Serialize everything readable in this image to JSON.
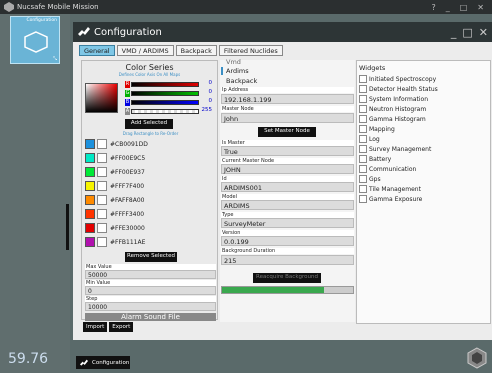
{
  "window": {
    "title": "Nucsafe Mobile Mission",
    "controls": [
      "?",
      "_",
      "□",
      "✕"
    ]
  },
  "sidebar": {
    "tile_label": "Configuration",
    "clock": "59.76"
  },
  "config": {
    "title": "Configuration",
    "controls": [
      "_",
      "□",
      "✕"
    ],
    "tabs": [
      "General",
      "VMD / ARDIMS",
      "Backpack",
      "Filtered Nuclides"
    ],
    "active_tab": "General"
  },
  "color_series": {
    "title": "Color Series",
    "subtitle": "Defines Color Axis On All Maps",
    "channels": [
      {
        "name": "R",
        "value": "0",
        "color": "#e00000"
      },
      {
        "name": "G",
        "value": "0",
        "color": "#00b000"
      },
      {
        "name": "B",
        "value": "0",
        "color": "#0000e0"
      },
      {
        "name": "A",
        "value": "255",
        "color": "#888888"
      }
    ],
    "add_label": "Add Selected",
    "drag_hint": "Drag Rectangle to Re-Order",
    "swatches": [
      {
        "hex": "#CB0091DD",
        "color": "#1d91dd"
      },
      {
        "hex": "#FF00E9C5",
        "color": "#00e9c5"
      },
      {
        "hex": "#FF00E937",
        "color": "#00e937"
      },
      {
        "hex": "#FFF7F400",
        "color": "#f7f400"
      },
      {
        "hex": "#FAFF8A00",
        "color": "#ff8a00"
      },
      {
        "hex": "#FFFF3400",
        "color": "#ff3400"
      },
      {
        "hex": "#FFE30000",
        "color": "#e30000"
      },
      {
        "hex": "#FFB111AE",
        "color": "#b111ae"
      }
    ],
    "remove_label": "Remove Selected",
    "max_label": "Max Value",
    "max_value": "50000",
    "min_label": "Min Value",
    "min_value": "0",
    "step_label": "Step",
    "step_value": "10000",
    "alarm_label": "Alarm Sound File"
  },
  "buttons": {
    "import": "Import",
    "export": "Export"
  },
  "details": {
    "vmd": "Vmd",
    "ardims": "Ardims",
    "backpack": "Backpack",
    "ip_label": "Ip Address",
    "ip_value": "192.168.1.199",
    "master_node_label": "Master Node",
    "master_node_value": "John",
    "set_master_label": "Set Master Node",
    "is_master_label": "Is Master",
    "is_master_value": "True",
    "current_master_label": "Current Master Node",
    "current_master_value": "JOHN",
    "id_label": "Id",
    "id_value": "ARDIMS001",
    "model_label": "Model",
    "model_value": "ARDIMS",
    "type_label": "Type",
    "type_value": "SurveyMeter",
    "version_label": "Version",
    "version_value": "0.0.199",
    "bg_duration_label": "Background Duration",
    "bg_duration_value": "215",
    "reacquire_label": "Reacquire Background",
    "progress": 0.78
  },
  "widgets": {
    "title": "Widgets",
    "items": [
      "Initiated Spectroscopy",
      "Detector Health Status",
      "System Information",
      "Neutron Histogram",
      "Gamma Histogram",
      "Mapping",
      "Log",
      "Survey Management",
      "Battery",
      "Communication",
      "Gps",
      "Tile Management",
      "Gamma Exposure"
    ]
  },
  "taskbar": {
    "label": "Configuration"
  }
}
